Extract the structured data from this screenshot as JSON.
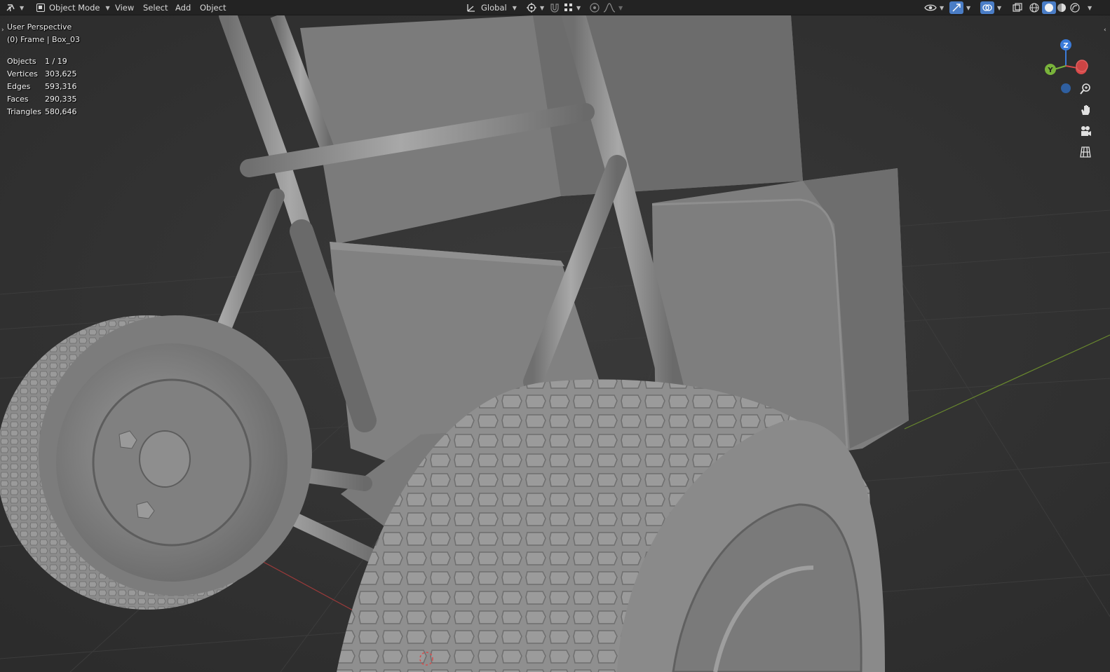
{
  "header": {
    "mode": "Object Mode",
    "menus": [
      "View",
      "Select",
      "Add",
      "Object"
    ],
    "transform_orientation": "Global"
  },
  "overlay": {
    "perspective": "User Perspective",
    "context": "(0) Frame | Box_03"
  },
  "stats": [
    {
      "label": "Objects",
      "value": "1 / 19"
    },
    {
      "label": "Vertices",
      "value": "303,625"
    },
    {
      "label": "Edges",
      "value": "593,316"
    },
    {
      "label": "Faces",
      "value": "290,335"
    },
    {
      "label": "Triangles",
      "value": "580,646"
    }
  ],
  "gizmo": {
    "z_label": "Z",
    "y_label": "Y",
    "colors": {
      "x": "#d94a4a",
      "y": "#79b33b",
      "z": "#3b7bd9"
    }
  },
  "nav_icons": [
    "zoom-icon",
    "pan-hand-icon",
    "camera-icon",
    "grid-projection-icon"
  ],
  "colors": {
    "header_bg": "#232323",
    "viewport_bg": "#303030",
    "mesh": "#8c8c8c",
    "accent_blue": "#4a7dc6"
  }
}
